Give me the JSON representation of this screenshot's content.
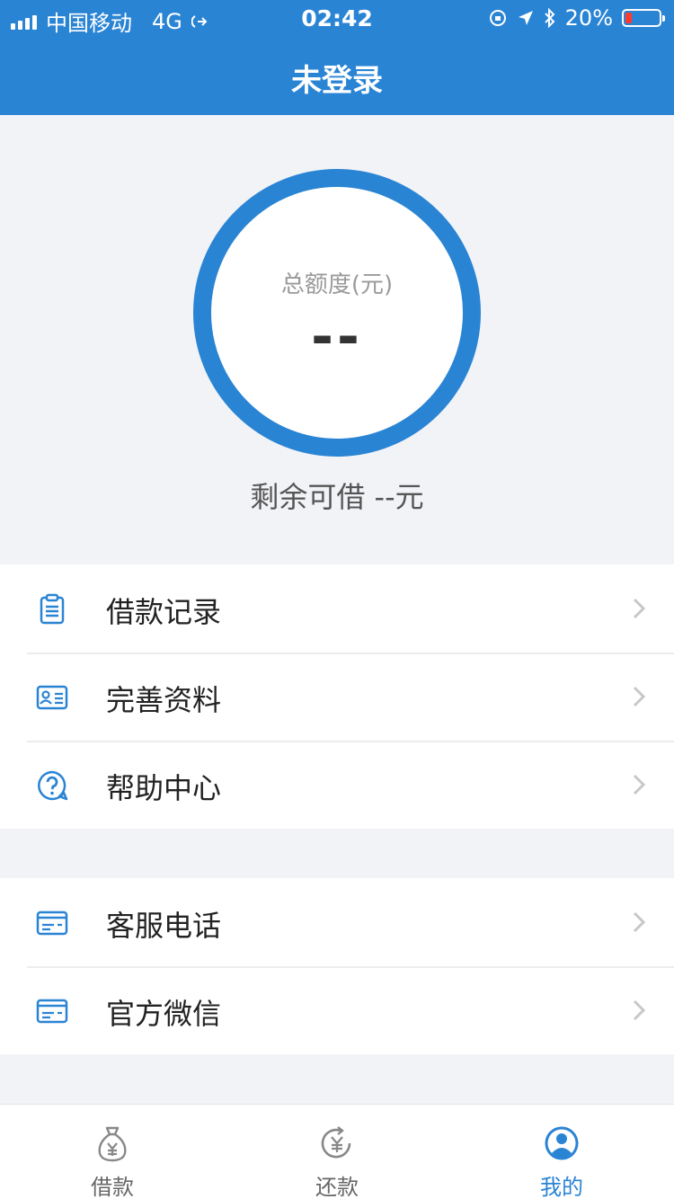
{
  "status_bar": {
    "carrier": "中国移动",
    "network": "4G",
    "time": "02:42",
    "battery": "20%",
    "battery_level": 0.2
  },
  "header": {
    "title": "未登录"
  },
  "credit": {
    "total_label": "总额度(元)",
    "total_value": "--",
    "remaining": "剩余可借 --元"
  },
  "menu_group_1": [
    {
      "label": "借款记录",
      "icon": "clipboard-icon"
    },
    {
      "label": "完善资料",
      "icon": "id-card-icon"
    },
    {
      "label": "帮助中心",
      "icon": "help-icon"
    }
  ],
  "menu_group_2": [
    {
      "label": "客服电话",
      "icon": "card-icon"
    },
    {
      "label": "官方微信",
      "icon": "card-icon"
    }
  ],
  "tabbar": {
    "items": [
      {
        "label": "借款",
        "icon": "money-bag-icon",
        "active": false
      },
      {
        "label": "还款",
        "icon": "repay-icon",
        "active": false
      },
      {
        "label": "我的",
        "icon": "user-icon",
        "active": true
      }
    ]
  },
  "colors": {
    "primary": "#2a84d4",
    "background": "#f2f3f7",
    "battery_low": "#ff3b30"
  }
}
